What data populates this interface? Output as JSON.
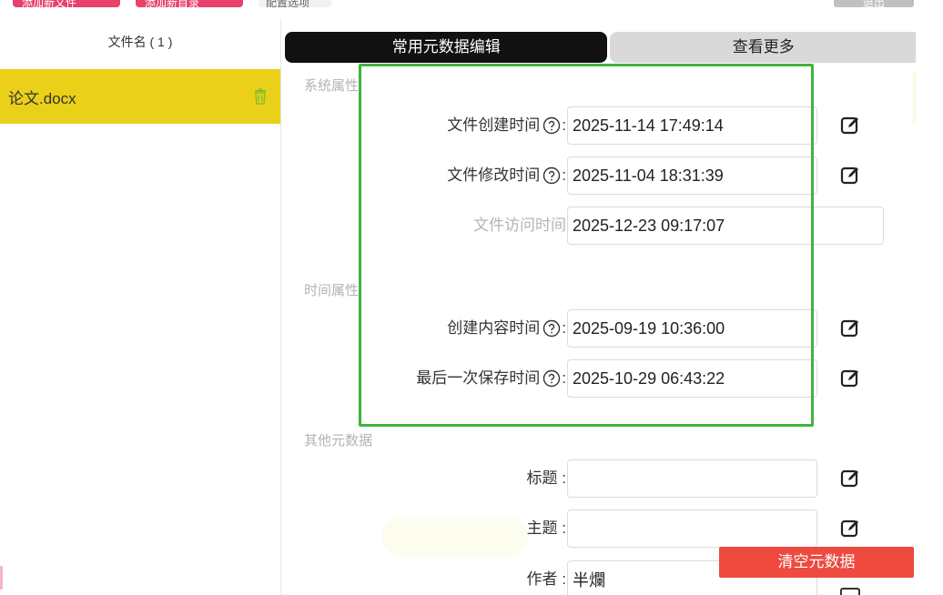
{
  "toolbar": {
    "btn1": "添加新文件",
    "btn2": "添加新目录",
    "text": "配置选项",
    "right": "退出"
  },
  "files": {
    "header": "文件名 ( 1 )",
    "items": [
      {
        "name": "论文.docx"
      }
    ]
  },
  "tabs": [
    {
      "label": "常用元数据编辑",
      "active": true
    },
    {
      "label": "查看更多",
      "active": false
    }
  ],
  "sections": {
    "system": "系统属性",
    "time": "时间属性",
    "other": "其他元数据"
  },
  "fields": {
    "created": {
      "label": "文件创建时间",
      "value": "2025-11-14 17:49:14"
    },
    "modified": {
      "label": "文件修改时间",
      "value": "2025-11-04 18:31:39"
    },
    "accessed": {
      "label": "文件访问时间",
      "value": "2025-12-23 09:17:07"
    },
    "content_created": {
      "label": "创建内容时间",
      "value": "2025-09-19 10:36:00"
    },
    "last_saved": {
      "label": "最后一次保存时间",
      "value": "2025-10-29 06:43:22"
    },
    "title": {
      "label": "标题 :",
      "value": ""
    },
    "subject": {
      "label": "主题 :",
      "value": ""
    },
    "author": {
      "label": "作者 :",
      "value": "半爛"
    }
  },
  "colon": ":",
  "buttons": {
    "clear": "清空元数据"
  },
  "colors": {
    "selected_file": "#ead018",
    "active_tab": "#111111",
    "highlight_border": "#3db53d",
    "clear_button": "#ee4a3f",
    "toolbar_button": "#e8416b"
  }
}
